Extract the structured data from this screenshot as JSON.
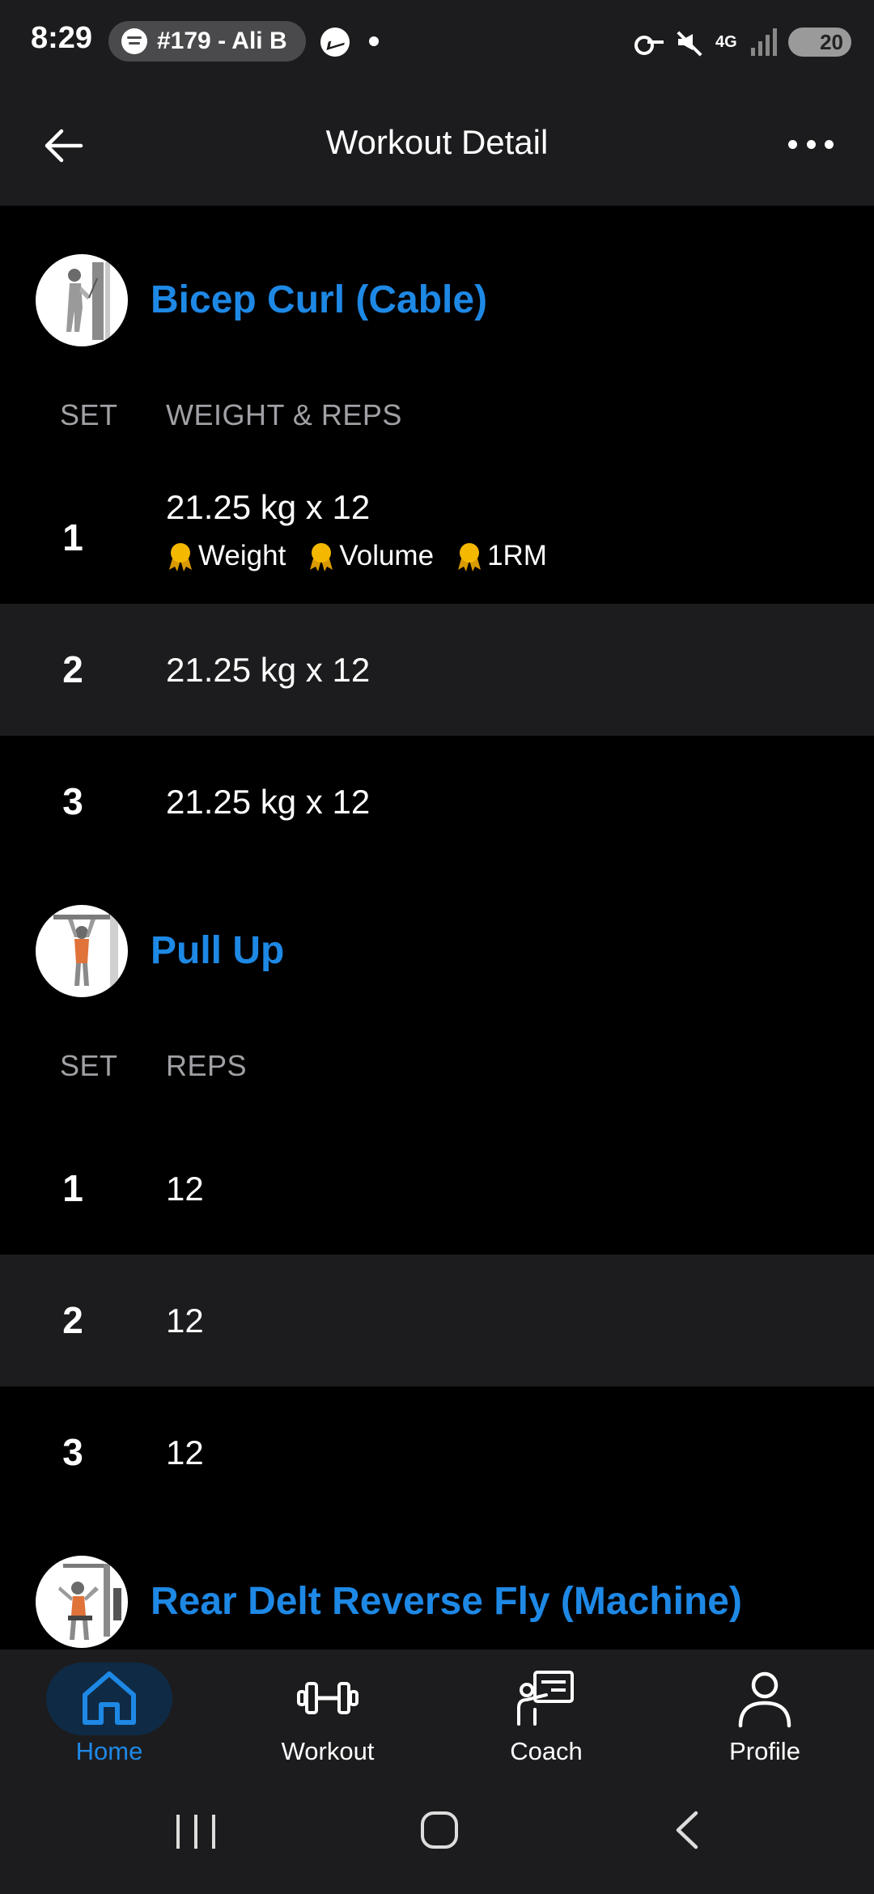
{
  "status_bar": {
    "time": "8:29",
    "notification_text": "#179 - Ali B",
    "network": "4G",
    "battery": "20"
  },
  "header": {
    "title": "Workout Detail"
  },
  "exercises": [
    {
      "name": "Bicep Curl (Cable)",
      "columns": [
        "SET",
        "WEIGHT & REPS"
      ],
      "sets": [
        {
          "set": "1",
          "value": "21.25 kg x 12",
          "records": [
            "Weight",
            "Volume",
            "1RM"
          ]
        },
        {
          "set": "2",
          "value": "21.25 kg x 12"
        },
        {
          "set": "3",
          "value": "21.25 kg x 12"
        }
      ]
    },
    {
      "name": "Pull Up",
      "columns": [
        "SET",
        "REPS"
      ],
      "sets": [
        {
          "set": "1",
          "value": "12"
        },
        {
          "set": "2",
          "value": "12"
        },
        {
          "set": "3",
          "value": "12"
        }
      ]
    },
    {
      "name": "Rear Delt Reverse Fly (Machine)"
    }
  ],
  "bottom_nav": {
    "items": [
      {
        "label": "Home",
        "icon": "home-icon",
        "active": true
      },
      {
        "label": "Workout",
        "icon": "dumbbell-icon",
        "active": false
      },
      {
        "label": "Coach",
        "icon": "coach-icon",
        "active": false
      },
      {
        "label": "Profile",
        "icon": "profile-icon",
        "active": false
      }
    ]
  },
  "colors": {
    "accent": "#1e88e5",
    "background": "#000000",
    "surface": "#1c1c1e",
    "medal": "#f5b800"
  }
}
